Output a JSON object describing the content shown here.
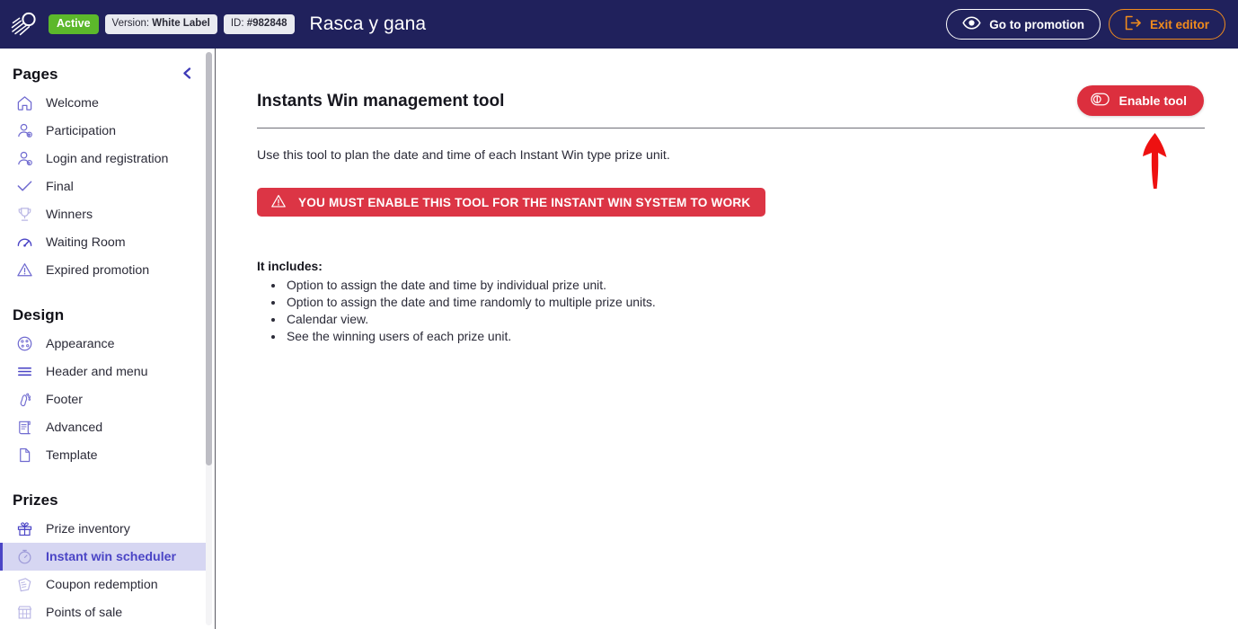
{
  "topbar": {
    "logo_icon": "comet-logo-icon",
    "status_badge": "Active",
    "version_label": "Version:",
    "version_value": "White Label",
    "id_label": "ID:",
    "id_value": "#982848",
    "promotion_title": "Rasca y gana",
    "go_to_promotion": "Go to promotion",
    "go_to_promotion_icon": "eye-icon",
    "exit_editor": "Exit editor",
    "exit_editor_icon": "logout-icon",
    "background_color": "#20215c",
    "active_badge_color": "#5cb82b",
    "exit_accent_color": "#f08b1d"
  },
  "sidebar": {
    "collapse_icon": "chevron-left-icon",
    "sections": [
      {
        "title": "Pages",
        "items": [
          {
            "label": "Welcome",
            "icon": "home-icon",
            "active": false
          },
          {
            "label": "Participation",
            "icon": "user-add-icon",
            "active": false
          },
          {
            "label": "Login and registration",
            "icon": "user-settings-icon",
            "active": false
          },
          {
            "label": "Final",
            "icon": "check-icon",
            "active": false
          },
          {
            "label": "Winners",
            "icon": "trophy-icon",
            "active": false
          },
          {
            "label": "Waiting Room",
            "icon": "speedometer-icon",
            "active": false
          },
          {
            "label": "Expired promotion",
            "icon": "warning-triangle-icon",
            "active": false
          }
        ]
      },
      {
        "title": "Design",
        "items": [
          {
            "label": "Appearance",
            "icon": "palette-icon",
            "active": false
          },
          {
            "label": "Header and menu",
            "icon": "menu-lines-icon",
            "active": false
          },
          {
            "label": "Footer",
            "icon": "footprint-icon",
            "active": false
          },
          {
            "label": "Advanced",
            "icon": "scroll-document-icon",
            "active": false
          },
          {
            "label": "Template",
            "icon": "page-icon",
            "active": false
          }
        ]
      },
      {
        "title": "Prizes",
        "items": [
          {
            "label": "Prize inventory",
            "icon": "gift-icon",
            "active": false
          },
          {
            "label": "Instant win scheduler",
            "icon": "stopwatch-icon",
            "active": true
          },
          {
            "label": "Coupon redemption",
            "icon": "coupon-icon",
            "active": false
          },
          {
            "label": "Points of sale",
            "icon": "store-icon",
            "active": false
          }
        ]
      }
    ],
    "active_item_color": "#4b45c6",
    "active_item_background": "#d6d6f2"
  },
  "main": {
    "page_title": "Instants Win management tool",
    "enable_button": "Enable tool",
    "enable_button_icon": "toggle-off-icon",
    "enable_button_color": "#dc2f3e",
    "lead_text": "Use this tool to plan the date and time of each Instant Win type prize unit.",
    "alert": {
      "icon": "warning-triangle-icon",
      "text": "YOU MUST ENABLE THIS TOOL FOR THE INSTANT WIN SYSTEM TO WORK",
      "color": "#dc3545"
    },
    "includes_heading": "It includes:",
    "includes": [
      "Option to assign the date and time by individual prize unit.",
      "Option to assign the date and time randomly to multiple prize units.",
      "Calendar view.",
      "See the winning users of each prize unit."
    ],
    "annotation_arrow_color": "#ee1111"
  }
}
